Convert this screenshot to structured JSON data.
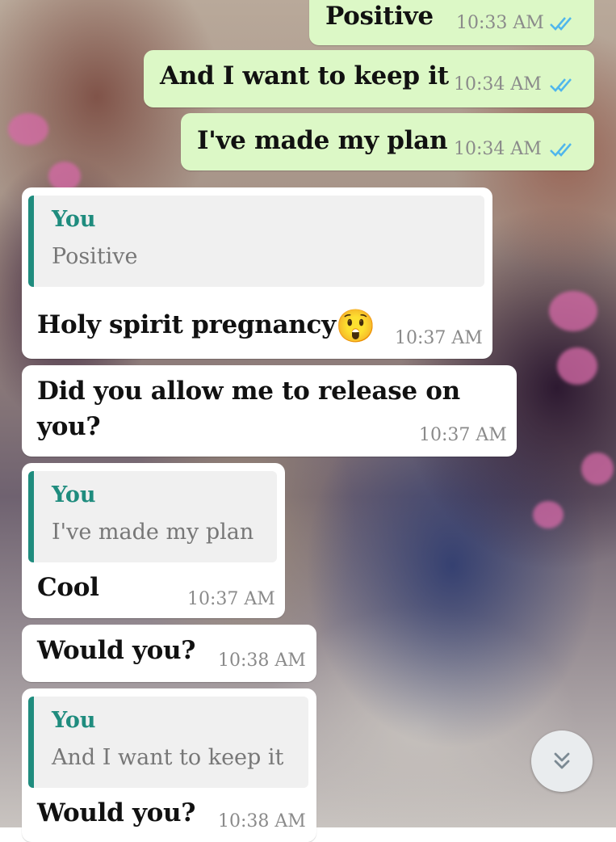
{
  "messages": [
    {
      "text": "Positive",
      "time": "10:33 AM"
    },
    {
      "text": "And  I want to keep it",
      "time": "10:34 AM"
    },
    {
      "text": "I've made my plan",
      "time": "10:34 AM"
    },
    {
      "quote_author": "You",
      "quote_text": "Positive",
      "text": "Holy spirit pregnancy",
      "emoji": "😲",
      "time": "10:37 AM"
    },
    {
      "line1": "Did you allow me to release on",
      "line2": "you?",
      "time": "10:37 AM"
    },
    {
      "quote_author": "You",
      "quote_text": "I've made my plan",
      "text": "Cool",
      "time": "10:37 AM"
    },
    {
      "text": "Would you?",
      "time": "10:38 AM"
    },
    {
      "quote_author": "You",
      "quote_text": "And  I want to keep it",
      "text": "Would you?",
      "time": "10:38 AM"
    }
  ],
  "colors": {
    "outgoing": "#dcf8c6",
    "incoming": "#ffffff",
    "quote_bar": "#1f8c7e",
    "read_ticks": "#4fb6ec"
  },
  "icons": {
    "read_receipt": "double-check-icon",
    "scroll_down": "chevron-double-down-icon"
  }
}
